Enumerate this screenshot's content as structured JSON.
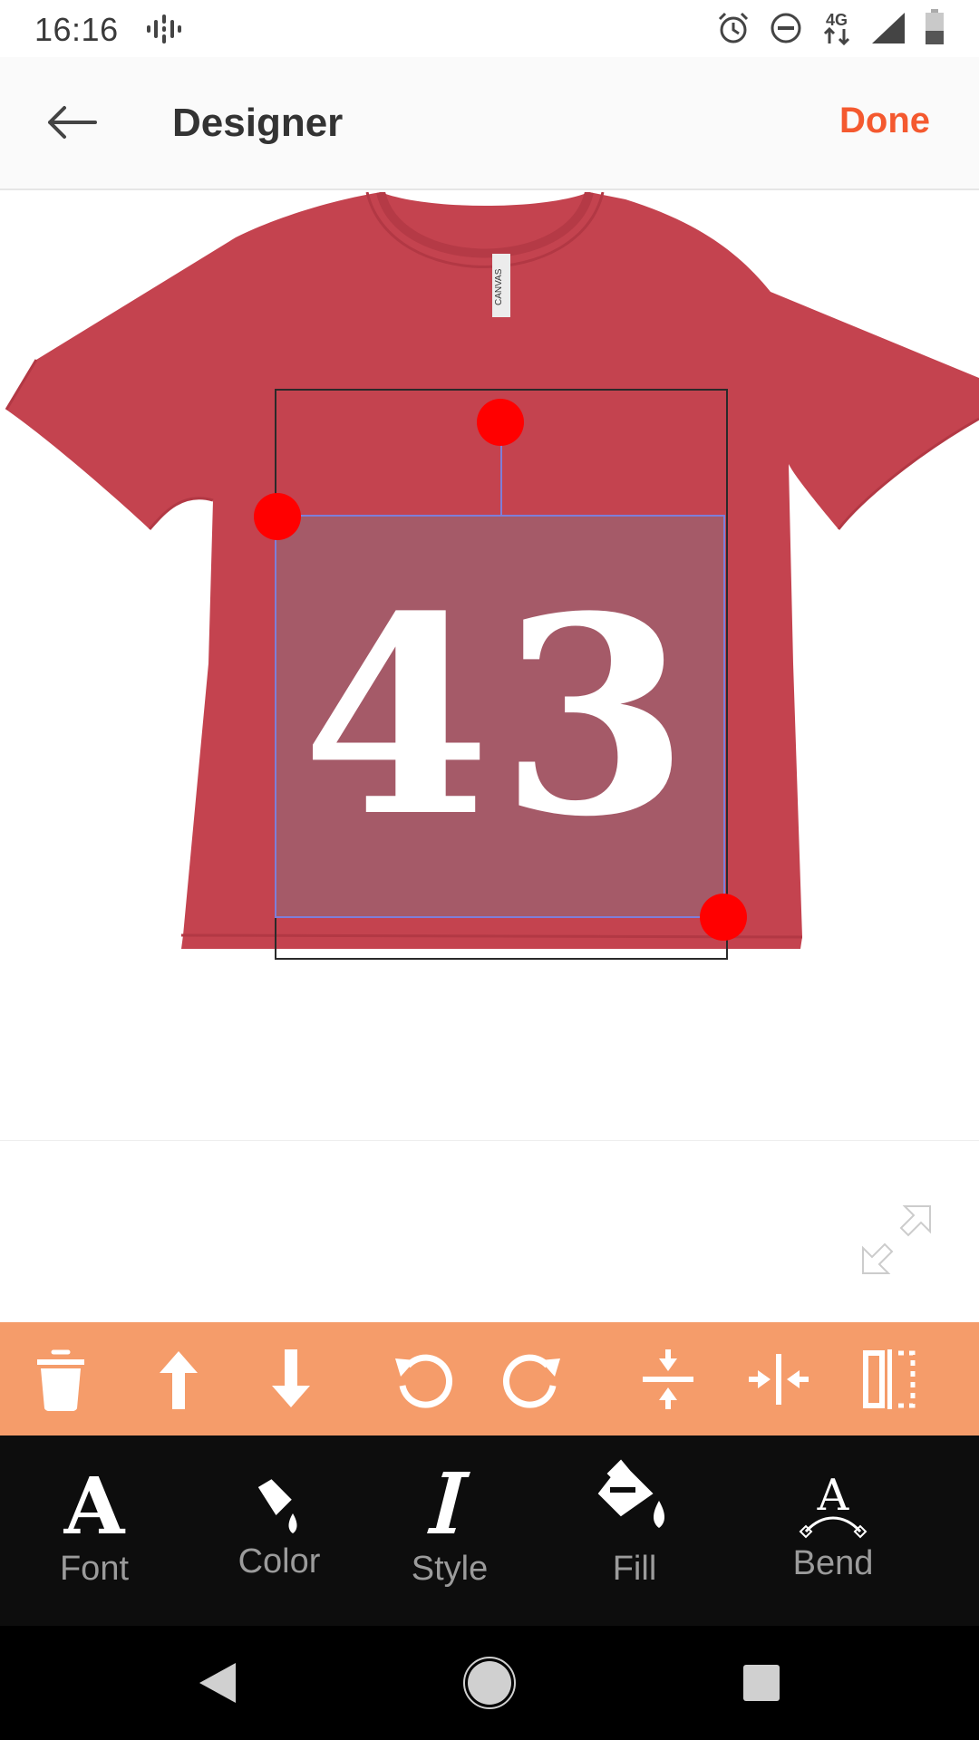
{
  "status_bar": {
    "time": "16:16",
    "network": "4G",
    "icons": [
      "podcast-icon",
      "alarm-icon",
      "do-not-disturb-icon",
      "network-4g-icon",
      "signal-icon",
      "battery-icon"
    ]
  },
  "app_bar": {
    "title": "Designer",
    "done_label": "Done",
    "back_icon": "arrow-left-icon"
  },
  "canvas": {
    "design_text": "43",
    "shirt_color": "#c4434f",
    "tag_text": "CANVAS",
    "selection_color": "#7e7ed8",
    "handle_color": "#ff0000"
  },
  "toolbar": {
    "background": "#f59c6a",
    "tools": [
      "trash-icon",
      "move-up-icon",
      "move-down-icon",
      "rotate-left-icon",
      "rotate-right-icon",
      "center-vertical-icon",
      "center-horizontal-icon",
      "flip-horizontal-icon"
    ]
  },
  "tabs": [
    {
      "label": "Font",
      "icon": "font-icon"
    },
    {
      "label": "Color",
      "icon": "paint-bucket-icon"
    },
    {
      "label": "Style",
      "icon": "italic-icon"
    },
    {
      "label": "Fill",
      "icon": "fill-icon"
    },
    {
      "label": "Bend",
      "icon": "bend-text-icon"
    }
  ],
  "nav_bar": {
    "buttons": [
      "back-triangle-icon",
      "home-circle-icon",
      "recents-square-icon"
    ]
  }
}
